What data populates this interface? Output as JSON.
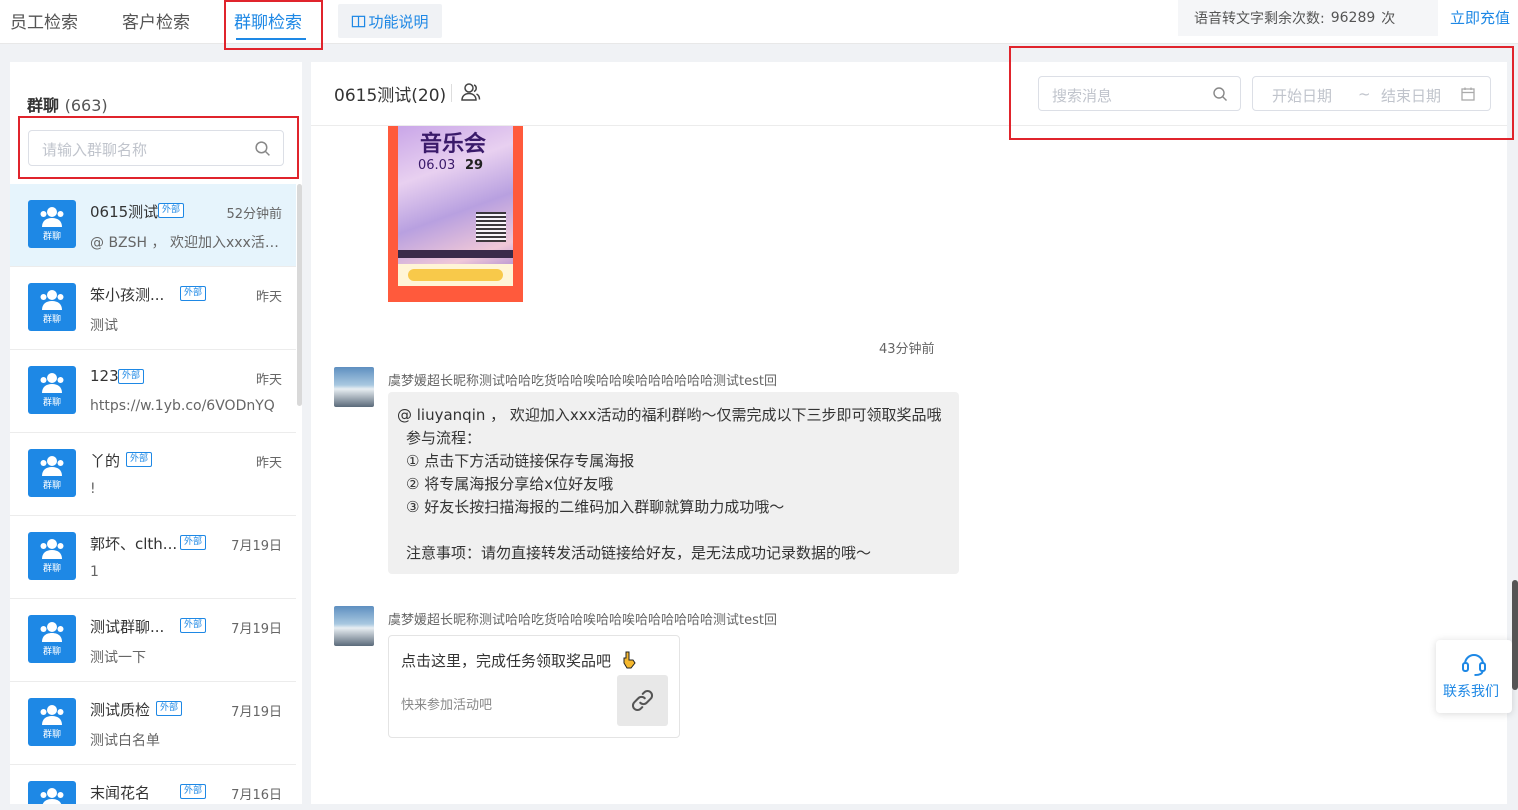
{
  "tabs": [
    {
      "label": "员工检索",
      "active": false
    },
    {
      "label": "客户检索",
      "active": false
    },
    {
      "label": "群聊检索",
      "active": true
    }
  ],
  "help_button": "功能说明",
  "quota": {
    "label": "语音转文字剩余次数:",
    "value": "96289",
    "unit": "次"
  },
  "recharge": "立即充值",
  "sidebar": {
    "title": "群聊",
    "count": "(663)",
    "search_placeholder": "请输入群聊名称",
    "avatar_label": "群聊",
    "ext_badge": "外部",
    "items": [
      {
        "name": "0615测试",
        "time": "52分钟前",
        "preview": "@ BZSH ， 欢迎加入xxx活动的福利群哟～仅需完成以下三步即可领取奖品哦",
        "selected": true
      },
      {
        "name": "笨小孩测...",
        "time": "昨天",
        "preview": "测试",
        "selected": false
      },
      {
        "name": "123",
        "time": "昨天",
        "preview": "https://w.1yb.co/6VODnYQ",
        "selected": false
      },
      {
        "name": "丫的",
        "time": "昨天",
        "preview": "!",
        "selected": false
      },
      {
        "name": "郭坏、clth...",
        "time": "7月19日",
        "preview": "1",
        "selected": false
      },
      {
        "name": "测试群聊...",
        "time": "7月19日",
        "preview": "测试一下",
        "selected": false
      },
      {
        "name": "测试质检",
        "time": "7月19日",
        "preview": "测试白名单",
        "selected": false
      },
      {
        "name": "末闻花名",
        "time": "7月16日",
        "preview": "",
        "selected": false
      }
    ]
  },
  "chat": {
    "title": "0615测试(20)",
    "search_placeholder": "搜索消息",
    "start_date": "开始日期",
    "date_sep": "~",
    "end_date": "结束日期",
    "poster": {
      "logo": "音乐会",
      "date": "06.03",
      "num": "29"
    },
    "timestamp": "43分钟前",
    "messages": [
      {
        "sender": "虞梦媛超长昵称测试哈哈吃货哈哈唉哈哈唉哈哈哈哈哈哈测试test回",
        "lines": [
          "@ liuyanqin ， 欢迎加入xxx活动的福利群哟～仅需完成以下三步即可领取奖品哦",
          "参与流程：",
          "① 点击下方活动链接保存专属海报",
          "② 将专属海报分享给x位好友哦",
          "③ 好友长按扫描海报的二维码加入群聊就算助力成功哦～",
          "",
          "注意事项：请勿直接转发活动链接给好友，是无法成功记录数据的哦～"
        ]
      },
      {
        "sender": "虞梦媛超长昵称测试哈哈吃货哈哈唉哈哈唉哈哈哈哈哈哈测试test回",
        "card_title": "点击这里，完成任务领取奖品吧",
        "card_desc": "快来参加活动吧"
      }
    ]
  },
  "contact_us": "联系我们",
  "colors": {
    "accent": "#1e88e5",
    "highlight": "#e0242c",
    "selected_row": "#e6f4fc"
  }
}
